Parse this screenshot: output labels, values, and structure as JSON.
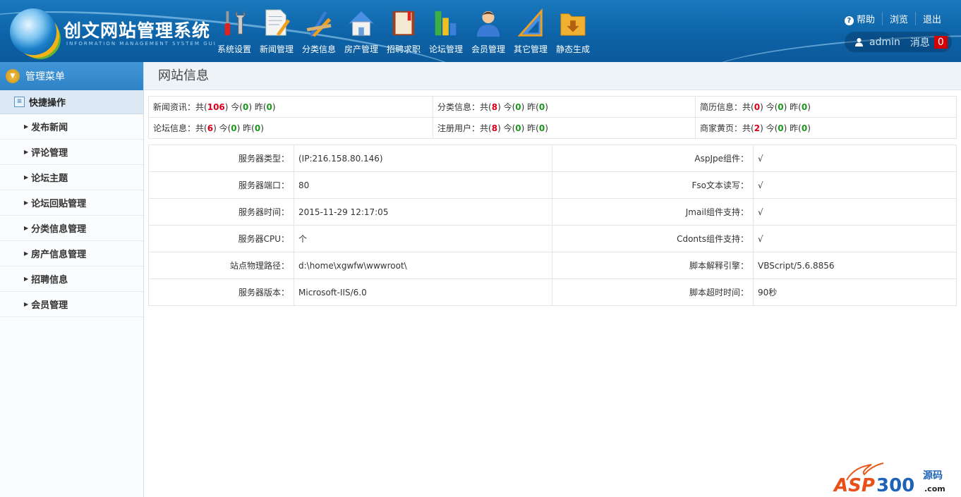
{
  "header": {
    "logo_title": "创文网站管理系统",
    "logo_subtitle": "INFORMATION MANAGEMENT SYSTEM GUI",
    "nav": [
      {
        "label": "系统设置",
        "icon": "tools-icon"
      },
      {
        "label": "新闻管理",
        "icon": "document-pencil-icon"
      },
      {
        "label": "分类信息",
        "icon": "ruler-pencil-icon"
      },
      {
        "label": "房产管理",
        "icon": "house-icon"
      },
      {
        "label": "招聘求职",
        "icon": "book-icon"
      },
      {
        "label": "论坛管理",
        "icon": "bar-chart-icon"
      },
      {
        "label": "会员管理",
        "icon": "user-icon"
      },
      {
        "label": "其它管理",
        "icon": "triangle-ruler-icon"
      },
      {
        "label": "静态生成",
        "icon": "folder-download-icon"
      }
    ],
    "links": {
      "help": "帮助",
      "browse": "浏览",
      "logout": "退出"
    },
    "user": {
      "name": "admin",
      "messages_label": "消息",
      "messages_count": "0"
    }
  },
  "sidebar": {
    "title": "管理菜单",
    "section": "快捷操作",
    "items": [
      "发布新闻",
      "评论管理",
      "论坛主题",
      "论坛回贴管理",
      "分类信息管理",
      "房产信息管理",
      "招聘信息",
      "会员管理"
    ]
  },
  "main": {
    "title": "网站信息",
    "stats": [
      [
        {
          "label": "新闻资讯：",
          "total": "106",
          "today": "0",
          "yesterday": "0"
        },
        {
          "label": "分类信息：",
          "total": "8",
          "today": "0",
          "yesterday": "0"
        },
        {
          "label": "简历信息：",
          "total": "0",
          "today": "0",
          "yesterday": "0"
        }
      ],
      [
        {
          "label": "论坛信息：",
          "total": "6",
          "today": "0",
          "yesterday": "0"
        },
        {
          "label": "注册用户：",
          "total": "8",
          "today": "0",
          "yesterday": "0"
        },
        {
          "label": "商家黄页：",
          "total": "2",
          "today": "0",
          "yesterday": "0"
        }
      ]
    ],
    "stat_words": {
      "total": "共",
      "today": "今",
      "yesterday": "昨"
    },
    "server": [
      [
        "服务器类型：",
        "(IP:216.158.80.146)",
        "AspJpe组件：",
        "√"
      ],
      [
        "服务器端口：",
        "80",
        "Fso文本读写：",
        "√"
      ],
      [
        "服务器时间：",
        "2015-11-29 12:17:05",
        "Jmail组件支持：",
        "√"
      ],
      [
        "服务器CPU：",
        "个",
        "Cdonts组件支持：",
        "√"
      ],
      [
        "站点物理路径：",
        "d:\\home\\xgwfw\\wwwroot\\",
        "脚本解释引擎：",
        "VBScript/5.6.8856"
      ],
      [
        "服务器版本：",
        "Microsoft-IIS/6.0",
        "脚本超时时间：",
        "90秒"
      ]
    ]
  },
  "watermark": "ASP300 源码 .com"
}
